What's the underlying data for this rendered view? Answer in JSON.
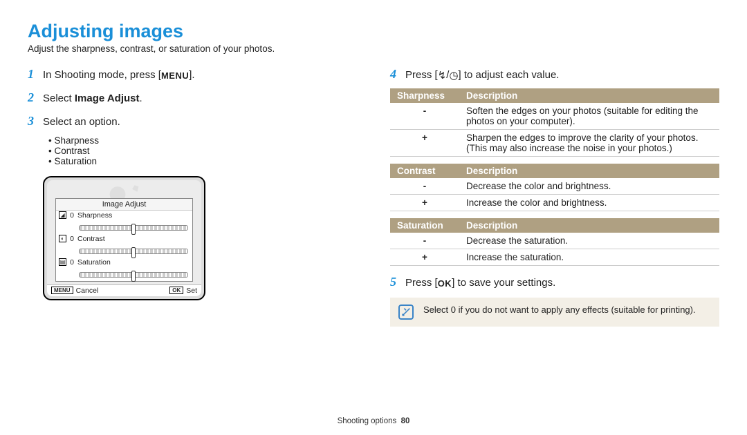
{
  "title": "Adjusting images",
  "subtitle": "Adjust the sharpness, contrast, or saturation of your photos.",
  "steps": {
    "s1_pre": "In Shooting mode, press [",
    "s1_btn": "MENU",
    "s1_post": "].",
    "s2_pre": "Select ",
    "s2_bold": "Image Adjust",
    "s2_post": ".",
    "s3": "Select an option.",
    "s3_bullets": [
      "Sharpness",
      "Contrast",
      "Saturation"
    ],
    "s4_pre": "Press [",
    "s4_icon1": "↯",
    "s4_sep": "/",
    "s4_icon2": "◷",
    "s4_post": "] to adjust each value.",
    "s5_pre": "Press [",
    "s5_btn": "OK",
    "s5_post": "] to save your settings."
  },
  "lcd": {
    "popup_title": "Image Adjust",
    "rows": [
      "Sharpness",
      "Contrast",
      "Saturation"
    ],
    "values": [
      "0",
      "0",
      "0"
    ],
    "cancel_key": "MENU",
    "cancel_label": "Cancel",
    "set_key": "OK",
    "set_label": "Set"
  },
  "tables": {
    "sharpness": {
      "col1": "Sharpness",
      "col2": "Description",
      "rows": [
        {
          "k": "-",
          "v": "Soften the edges on your photos (suitable for editing the photos on your computer)."
        },
        {
          "k": "+",
          "v": "Sharpen the edges to improve the clarity of your photos. (This may also increase the noise in your photos.)"
        }
      ]
    },
    "contrast": {
      "col1": "Contrast",
      "col2": "Description",
      "rows": [
        {
          "k": "-",
          "v": "Decrease the color and brightness."
        },
        {
          "k": "+",
          "v": "Increase the color and brightness."
        }
      ]
    },
    "saturation": {
      "col1": "Saturation",
      "col2": "Description",
      "rows": [
        {
          "k": "-",
          "v": "Decrease the saturation."
        },
        {
          "k": "+",
          "v": "Increase the saturation."
        }
      ]
    }
  },
  "note": "Select 0 if you do not want to apply any effects (suitable for printing).",
  "footer_section": "Shooting options",
  "footer_page": "80"
}
